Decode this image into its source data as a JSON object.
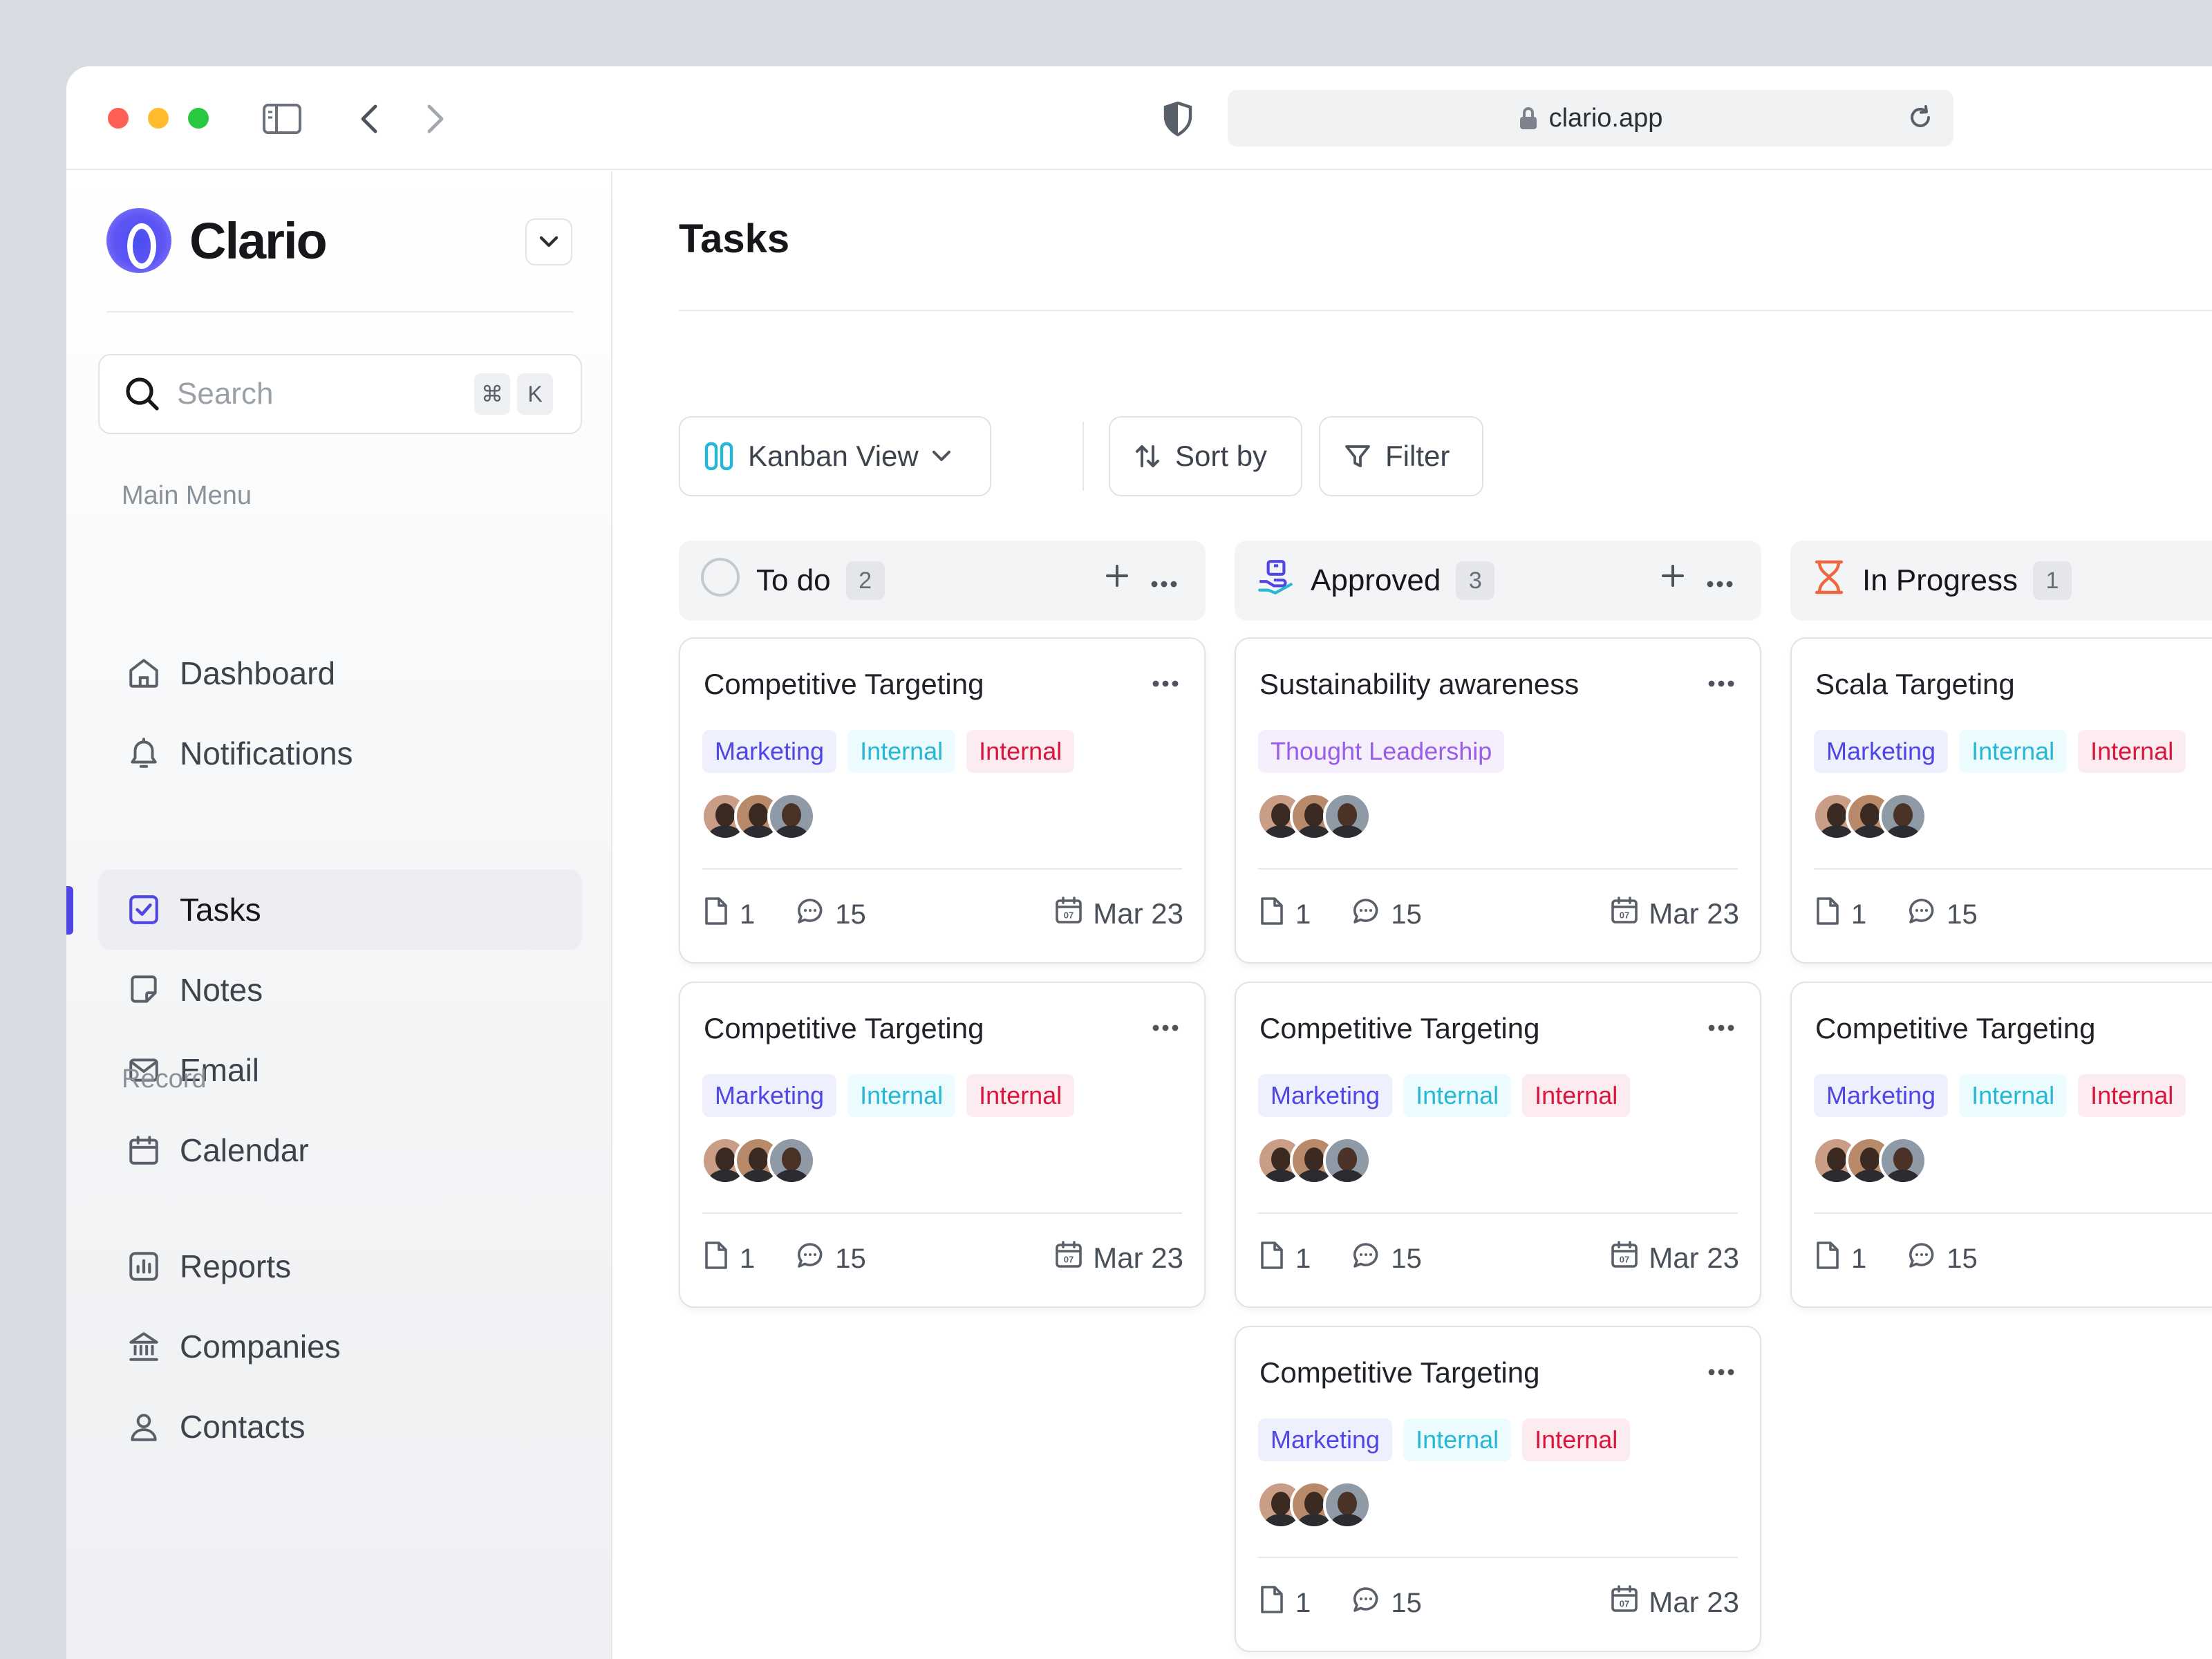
{
  "browser": {
    "url": "clario.app"
  },
  "sidebar": {
    "brand": "Clario",
    "search": {
      "placeholder": "Search",
      "shortcut_mod": "⌘",
      "shortcut_key": "K"
    },
    "main_menu_label": "Main Menu",
    "main_menu": [
      {
        "label": "Dashboard",
        "icon": "home-icon"
      },
      {
        "label": "Notifications",
        "icon": "bell-icon"
      },
      {
        "label": "Tasks",
        "icon": "checkbox-icon",
        "active": true
      },
      {
        "label": "Notes",
        "icon": "note-icon"
      },
      {
        "label": "Email",
        "icon": "mail-icon"
      },
      {
        "label": "Calendar",
        "icon": "calendar-icon"
      }
    ],
    "record_label": "Record",
    "record_menu": [
      {
        "label": "Reports",
        "icon": "chart-icon"
      },
      {
        "label": "Companies",
        "icon": "bank-icon"
      },
      {
        "label": "Contacts",
        "icon": "user-icon"
      }
    ]
  },
  "main": {
    "title": "Tasks",
    "toolbar": {
      "view": "Kanban View",
      "sort": "Sort by",
      "filter": "Filter"
    },
    "columns": [
      {
        "name": "To do",
        "count": "2",
        "cards": [
          {
            "title": "Competitive Targeting",
            "tags": [
              "Marketing",
              "Internal",
              "Internal"
            ],
            "files": "1",
            "comments": "15",
            "due": "Mar 23"
          },
          {
            "title": "Competitive Targeting",
            "tags": [
              "Marketing",
              "Internal",
              "Internal"
            ],
            "files": "1",
            "comments": "15",
            "due": "Mar 23"
          }
        ]
      },
      {
        "name": "Approved",
        "count": "3",
        "cards": [
          {
            "title": "Sustainability awareness",
            "tags": [
              "Thought Leadership"
            ],
            "files": "1",
            "comments": "15",
            "due": "Mar 23"
          },
          {
            "title": "Competitive Targeting",
            "tags": [
              "Marketing",
              "Internal",
              "Internal"
            ],
            "files": "1",
            "comments": "15",
            "due": "Mar 23"
          },
          {
            "title": "Competitive Targeting",
            "tags": [
              "Marketing",
              "Internal",
              "Internal"
            ],
            "files": "1",
            "comments": "15",
            "due": "Mar 23"
          }
        ]
      },
      {
        "name": "In Progress",
        "count": "1",
        "cards": [
          {
            "title": "Scala Targeting",
            "tags": [
              "Marketing",
              "Internal",
              "Internal"
            ],
            "files": "1",
            "comments": "15",
            "due": ""
          },
          {
            "title": "Competitive Targeting",
            "tags": [
              "Marketing",
              "Internal",
              "Internal"
            ],
            "files": "1",
            "comments": "15",
            "due": ""
          }
        ]
      }
    ]
  },
  "colors": {
    "accent": "#4f46e5",
    "tag_marketing": "#4f46e5",
    "tag_internal_cyan": "#25b7d3",
    "tag_internal_red": "#d9143d",
    "tag_thought": "#9a5de5",
    "in_progress": "#f0663c"
  }
}
